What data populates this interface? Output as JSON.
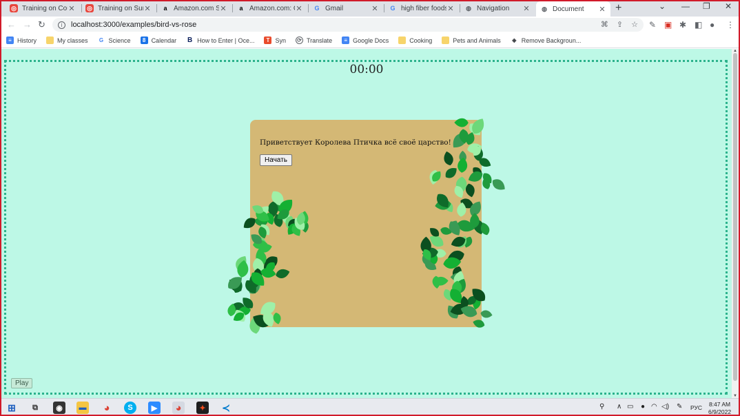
{
  "browser": {
    "tabs": [
      {
        "title": "Training on Count",
        "favicon": "training-icon",
        "color": "#e8453c"
      },
      {
        "title": "Training on Sum o",
        "favicon": "training-icon",
        "color": "#e8453c"
      },
      {
        "title": "Amazon.com Sho",
        "favicon": "amazon-icon",
        "color": "#000000"
      },
      {
        "title": "Amazon.com: Cu",
        "favicon": "amazon-icon",
        "color": "#000000"
      },
      {
        "title": "Gmail",
        "favicon": "google-icon",
        "color": "#4285f4"
      },
      {
        "title": "high fiber foods l",
        "favicon": "google-icon",
        "color": "#4285f4"
      },
      {
        "title": "Navigation",
        "favicon": "globe-icon",
        "color": "#5f6368"
      },
      {
        "title": "Document",
        "favicon": "globe-icon",
        "color": "#5f6368"
      }
    ],
    "active_tab": 7,
    "url": "localhost:3000/examples/bird-vs-rose",
    "bookmarks": [
      {
        "label": "History",
        "icon": "docs-icon"
      },
      {
        "label": "My classes",
        "icon": "folder-icon"
      },
      {
        "label": "Science",
        "icon": "google-icon"
      },
      {
        "label": "Calendar",
        "icon": "calendar-icon"
      },
      {
        "label": "How to Enter | Oce...",
        "icon": "b-icon"
      },
      {
        "label": "Syn",
        "icon": "syn-icon"
      },
      {
        "label": "Translate",
        "icon": "translate-icon"
      },
      {
        "label": "Google Docs",
        "icon": "docs-icon"
      },
      {
        "label": "Cooking",
        "icon": "folder-icon"
      },
      {
        "label": "Pets and Animals",
        "icon": "folder-icon"
      },
      {
        "label": "Remove Backgroun...",
        "icon": "layers-icon"
      }
    ]
  },
  "page": {
    "background": "#bdf8e6",
    "timer": "00:00",
    "greeting": "Приветствует Королева Птичка всё своё царство!",
    "start_button": "Начать",
    "play_button": "Play",
    "card_color": "#d4b875"
  },
  "taskbar": {
    "language": "РУС",
    "time": "8:47 AM",
    "date": "6/9/2022"
  }
}
